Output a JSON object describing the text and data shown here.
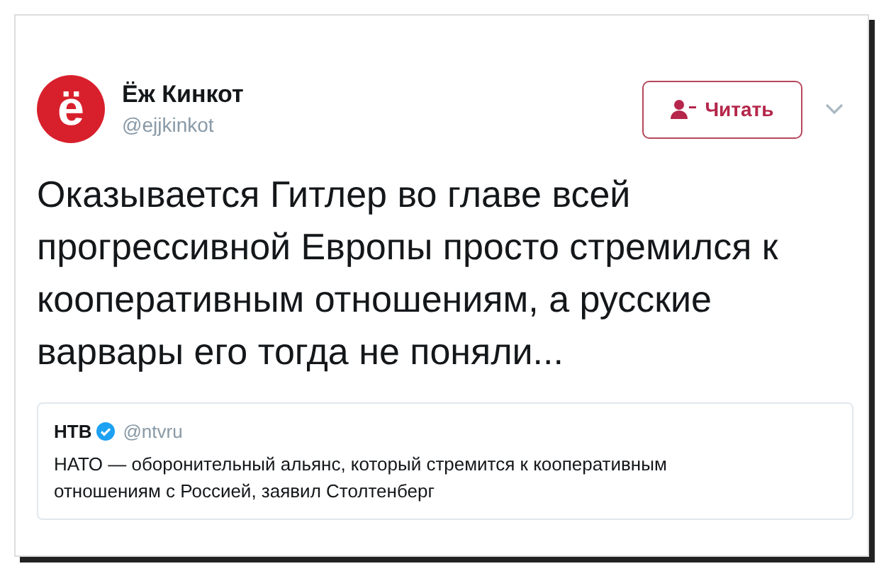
{
  "tweet": {
    "avatar": {
      "letter": "ё"
    },
    "name": "Ёж Кинкот",
    "handle": "@ejjkinkot",
    "follow_button": "Читать",
    "text": "Оказывается Гитлер во главе всей прогрессивной Европы просто стремился к кооперативным отношениям, а русские варвары его тогда не поняли...",
    "quoted": {
      "name": "НТВ",
      "verified": true,
      "handle": "@ntvru",
      "text": "НАТО — оборонительный альянс, который стремится к кооперативным отношениям с Россией, заявил Столтенберг"
    }
  }
}
